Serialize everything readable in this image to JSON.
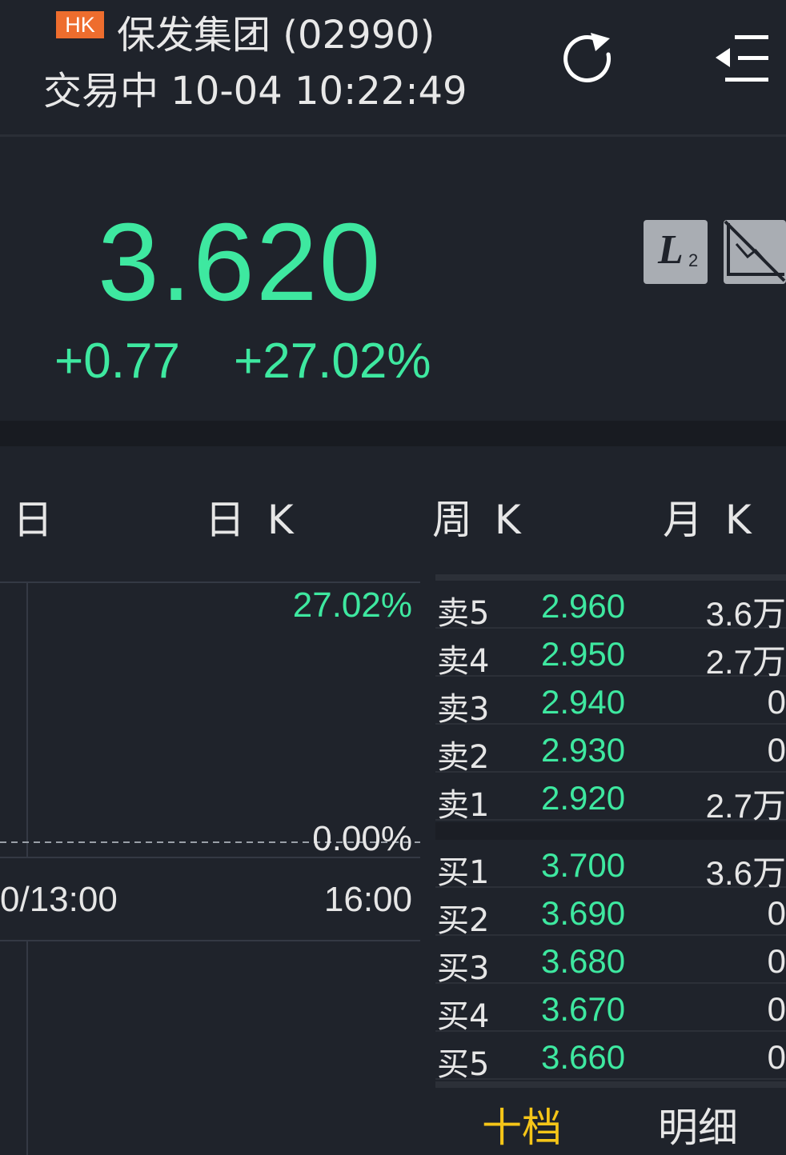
{
  "header": {
    "market_badge": "HK",
    "stock_name": "保发集团 (02990)",
    "status": "交易中",
    "datetime": "10-04 10:22:49",
    "icons": {
      "refresh": "refresh-icon",
      "menu": "menu-collapse-icon"
    }
  },
  "quote": {
    "price": "3.620",
    "change": "+0.77",
    "change_pct": "+27.02%",
    "color_up": "#3ee8a0",
    "l2_label": "L",
    "l2_sub": "2"
  },
  "tabs": [
    "日",
    "日 K",
    "周 K",
    "月 K"
  ],
  "chart": {
    "top_pct": "27.02%",
    "zero_pct": "0.00%",
    "time_left": "0/13:00",
    "time_right": "16:00"
  },
  "order_book": {
    "asks": [
      {
        "label": "卖5",
        "price": "2.960",
        "volume": "3.6万"
      },
      {
        "label": "卖4",
        "price": "2.950",
        "volume": "2.7万"
      },
      {
        "label": "卖3",
        "price": "2.940",
        "volume": "0"
      },
      {
        "label": "卖2",
        "price": "2.930",
        "volume": "0"
      },
      {
        "label": "卖1",
        "price": "2.920",
        "volume": "2.7万"
      }
    ],
    "bids": [
      {
        "label": "买1",
        "price": "3.700",
        "volume": "3.6万"
      },
      {
        "label": "买2",
        "price": "3.690",
        "volume": "0"
      },
      {
        "label": "买3",
        "price": "3.680",
        "volume": "0"
      },
      {
        "label": "买4",
        "price": "3.670",
        "volume": "0"
      },
      {
        "label": "买5",
        "price": "3.660",
        "volume": "0"
      }
    ],
    "bottom_tabs": [
      "十档",
      "明细"
    ],
    "active_tab_color": "#f5c518"
  }
}
